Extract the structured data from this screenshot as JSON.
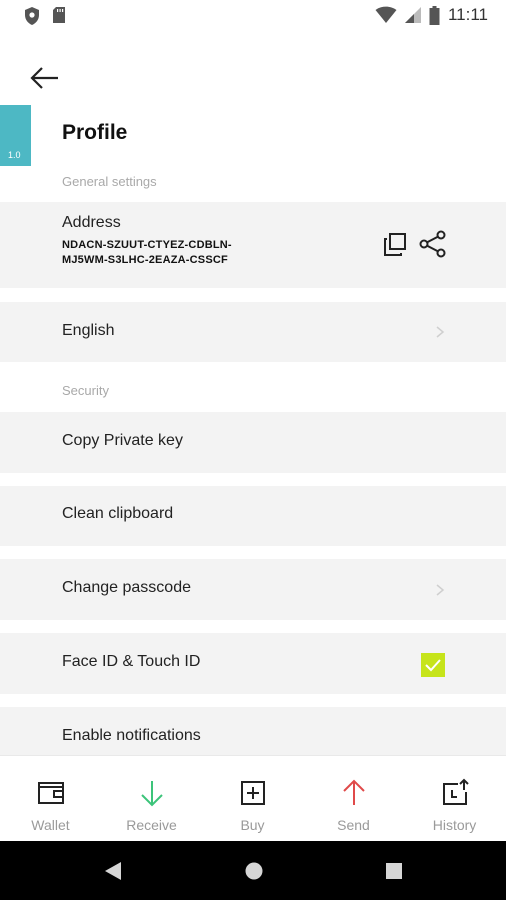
{
  "status_bar": {
    "time": "11:11"
  },
  "version": "1.0",
  "page": {
    "title": "Profile"
  },
  "sections": {
    "general": "General settings",
    "security": "Security"
  },
  "address": {
    "label": "Address",
    "line1": "NDACN-SZUUT-CTYEZ-CDBLN-",
    "line2": "MJ5WM-S3LHC-2EAZA-CSSCF"
  },
  "language": {
    "label": "English"
  },
  "security_items": {
    "copy_key": "Copy Private key",
    "clean_clipboard": "Clean clipboard",
    "change_passcode": "Change passcode",
    "face_touch_id": "Face ID & Touch ID",
    "notifications": "Enable notifications"
  },
  "face_id_enabled": true,
  "bottom_nav": {
    "wallet": "Wallet",
    "receive": "Receive",
    "buy": "Buy",
    "send": "Send",
    "history": "History"
  },
  "colors": {
    "accent_teal": "#4db8c4",
    "checkbox_lime": "#c6e41a",
    "receive_green": "#3cc47a",
    "send_red": "#e04a4a"
  }
}
